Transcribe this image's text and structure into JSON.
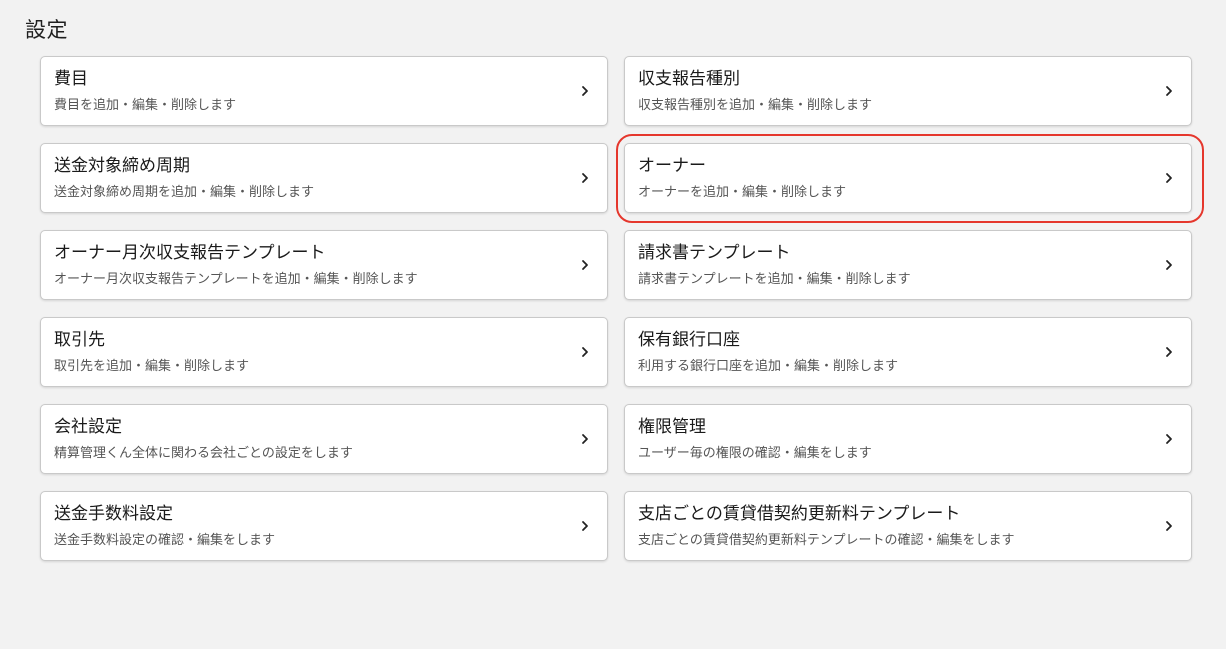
{
  "page": {
    "title": "設定"
  },
  "cards": [
    {
      "title": "費目",
      "description": "費目を追加・編集・削除します",
      "highlighted": false
    },
    {
      "title": "収支報告種別",
      "description": "収支報告種別を追加・編集・削除します",
      "highlighted": false
    },
    {
      "title": "送金対象締め周期",
      "description": "送金対象締め周期を追加・編集・削除します",
      "highlighted": false
    },
    {
      "title": "オーナー",
      "description": "オーナーを追加・編集・削除します",
      "highlighted": true
    },
    {
      "title": "オーナー月次収支報告テンプレート",
      "description": "オーナー月次収支報告テンプレートを追加・編集・削除します",
      "highlighted": false
    },
    {
      "title": "請求書テンプレート",
      "description": "請求書テンプレートを追加・編集・削除します",
      "highlighted": false
    },
    {
      "title": "取引先",
      "description": "取引先を追加・編集・削除します",
      "highlighted": false
    },
    {
      "title": "保有銀行口座",
      "description": "利用する銀行口座を追加・編集・削除します",
      "highlighted": false
    },
    {
      "title": "会社設定",
      "description": "精算管理くん全体に関わる会社ごとの設定をします",
      "highlighted": false
    },
    {
      "title": "権限管理",
      "description": "ユーザー毎の権限の確認・編集をします",
      "highlighted": false
    },
    {
      "title": "送金手数料設定",
      "description": "送金手数料設定の確認・編集をします",
      "highlighted": false
    },
    {
      "title": "支店ごとの賃貸借契約更新料テンプレート",
      "description": "支店ごとの賃貸借契約更新料テンプレートの確認・編集をします",
      "highlighted": false
    }
  ],
  "icons": {
    "card_arrow": "chevron-right-icon"
  },
  "colors": {
    "background": "#f2f2f2",
    "card_background": "#ffffff",
    "card_border": "#c9c9c9",
    "highlight": "#e5372d"
  }
}
